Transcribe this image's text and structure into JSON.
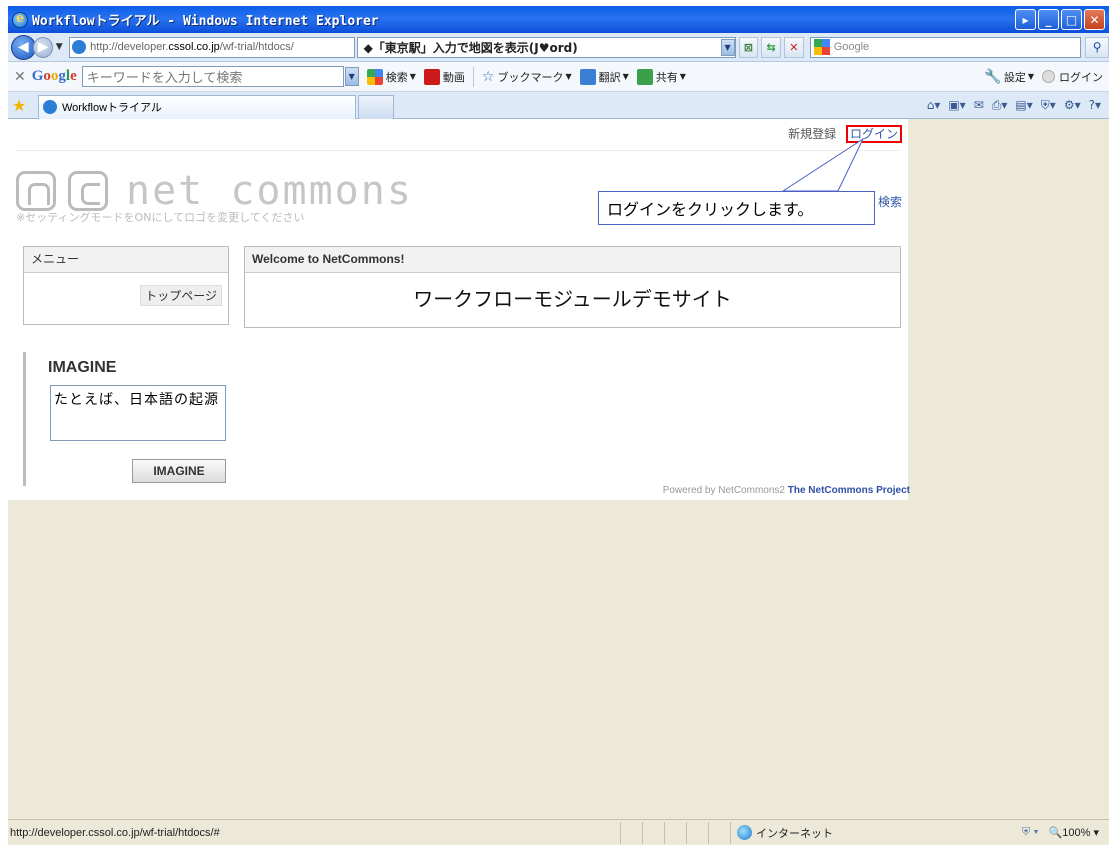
{
  "window": {
    "title": "Workflowトライアル - Windows Internet Explorer"
  },
  "address": {
    "url_prefix": "http://developer.",
    "url_domain": "cssol.co.jp",
    "url_path": "/wf-trial/htdocs/",
    "map_hint": "◆「東京駅」入力で地図を表示(J♥ord)",
    "search_placeholder": "Google"
  },
  "google_toolbar": {
    "search_placeholder": "キーワードを入力して検索",
    "search_label": "検索",
    "video_label": "動画",
    "bookmark_label": "ブックマーク",
    "translate_label": "翻訳",
    "share_label": "共有",
    "settings_label": "設定",
    "login_label": "ログイン"
  },
  "tabs": [
    {
      "label": "Workflowトライアル"
    }
  ],
  "page": {
    "register_link": "新規登録",
    "login_link": "ログイン",
    "logo_wordmark": "net commons",
    "logo_note": "※セッティングモードをONにしてロゴを変更してください",
    "search_link": "検索",
    "callout_text": "ログインをクリックします。",
    "menu": {
      "header": "メニュー",
      "items": [
        "トップページ"
      ]
    },
    "welcome": {
      "header": "Welcome to NetCommons!",
      "body": "ワークフローモジュールデモサイト"
    },
    "imagine": {
      "title": "IMAGINE",
      "input_value": "たとえば、日本語の起源",
      "button": "IMAGINE"
    },
    "powered_by": "Powered by NetCommons2",
    "powered_project": "The NetCommons Project"
  },
  "status": {
    "url": "http://developer.cssol.co.jp/wf-trial/htdocs/#",
    "zone": "インターネット",
    "zoom": "100%"
  }
}
